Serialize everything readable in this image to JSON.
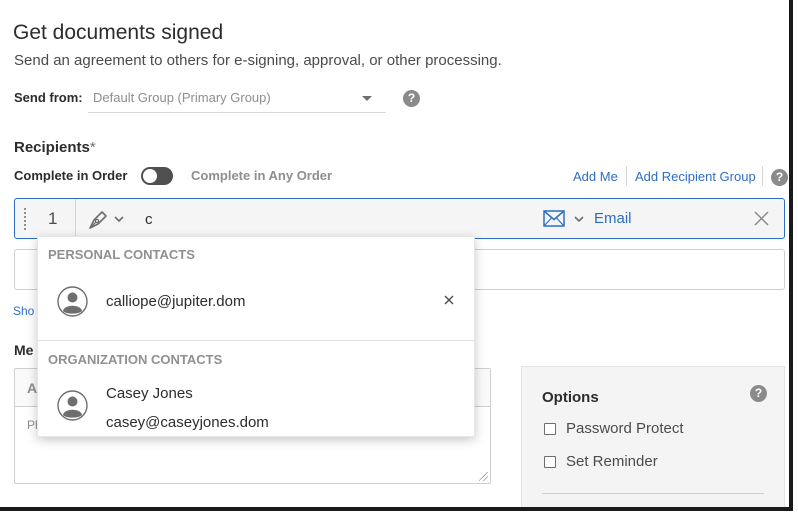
{
  "header": {
    "title": "Get documents signed",
    "subtitle": "Send an agreement to others for e-signing, approval, or other processing."
  },
  "send_from": {
    "label": "Send from:",
    "selected_value": "Default Group (Primary Group)"
  },
  "recipients": {
    "label": "Recipients",
    "required_marker": "*",
    "order_label": "Complete in Order",
    "any_order_label": "Complete in Any Order",
    "add_me": "Add Me",
    "add_recipient_group": "Add Recipient Group",
    "rows": [
      {
        "order": "1",
        "input_value": "c",
        "type_label": "Email"
      }
    ]
  },
  "partial_text": {
    "show_link": "Sho",
    "message_label": "Me",
    "message_header": "A",
    "message_body": "Pl"
  },
  "options": {
    "title": "Options",
    "items": [
      {
        "label": "Password Protect"
      },
      {
        "label": "Set Reminder"
      }
    ]
  },
  "dropdown": {
    "personal_header": "PERSONAL CONTACTS",
    "personal_contacts": [
      {
        "email": "calliope@jupiter.dom"
      }
    ],
    "org_header": "ORGANIZATION CONTACTS",
    "org_contacts": [
      {
        "name": "Casey Jones",
        "email": "casey@caseyjones.dom"
      }
    ]
  },
  "colors": {
    "accent": "#2d6ec4",
    "muted_text": "#8e8e8e",
    "toggle_off": "#505050"
  },
  "icons": [
    "drag-handle-icon",
    "pen-signer-icon",
    "chevron-down-icon",
    "envelope-icon",
    "close-icon",
    "help-icon",
    "avatar-icon"
  ]
}
